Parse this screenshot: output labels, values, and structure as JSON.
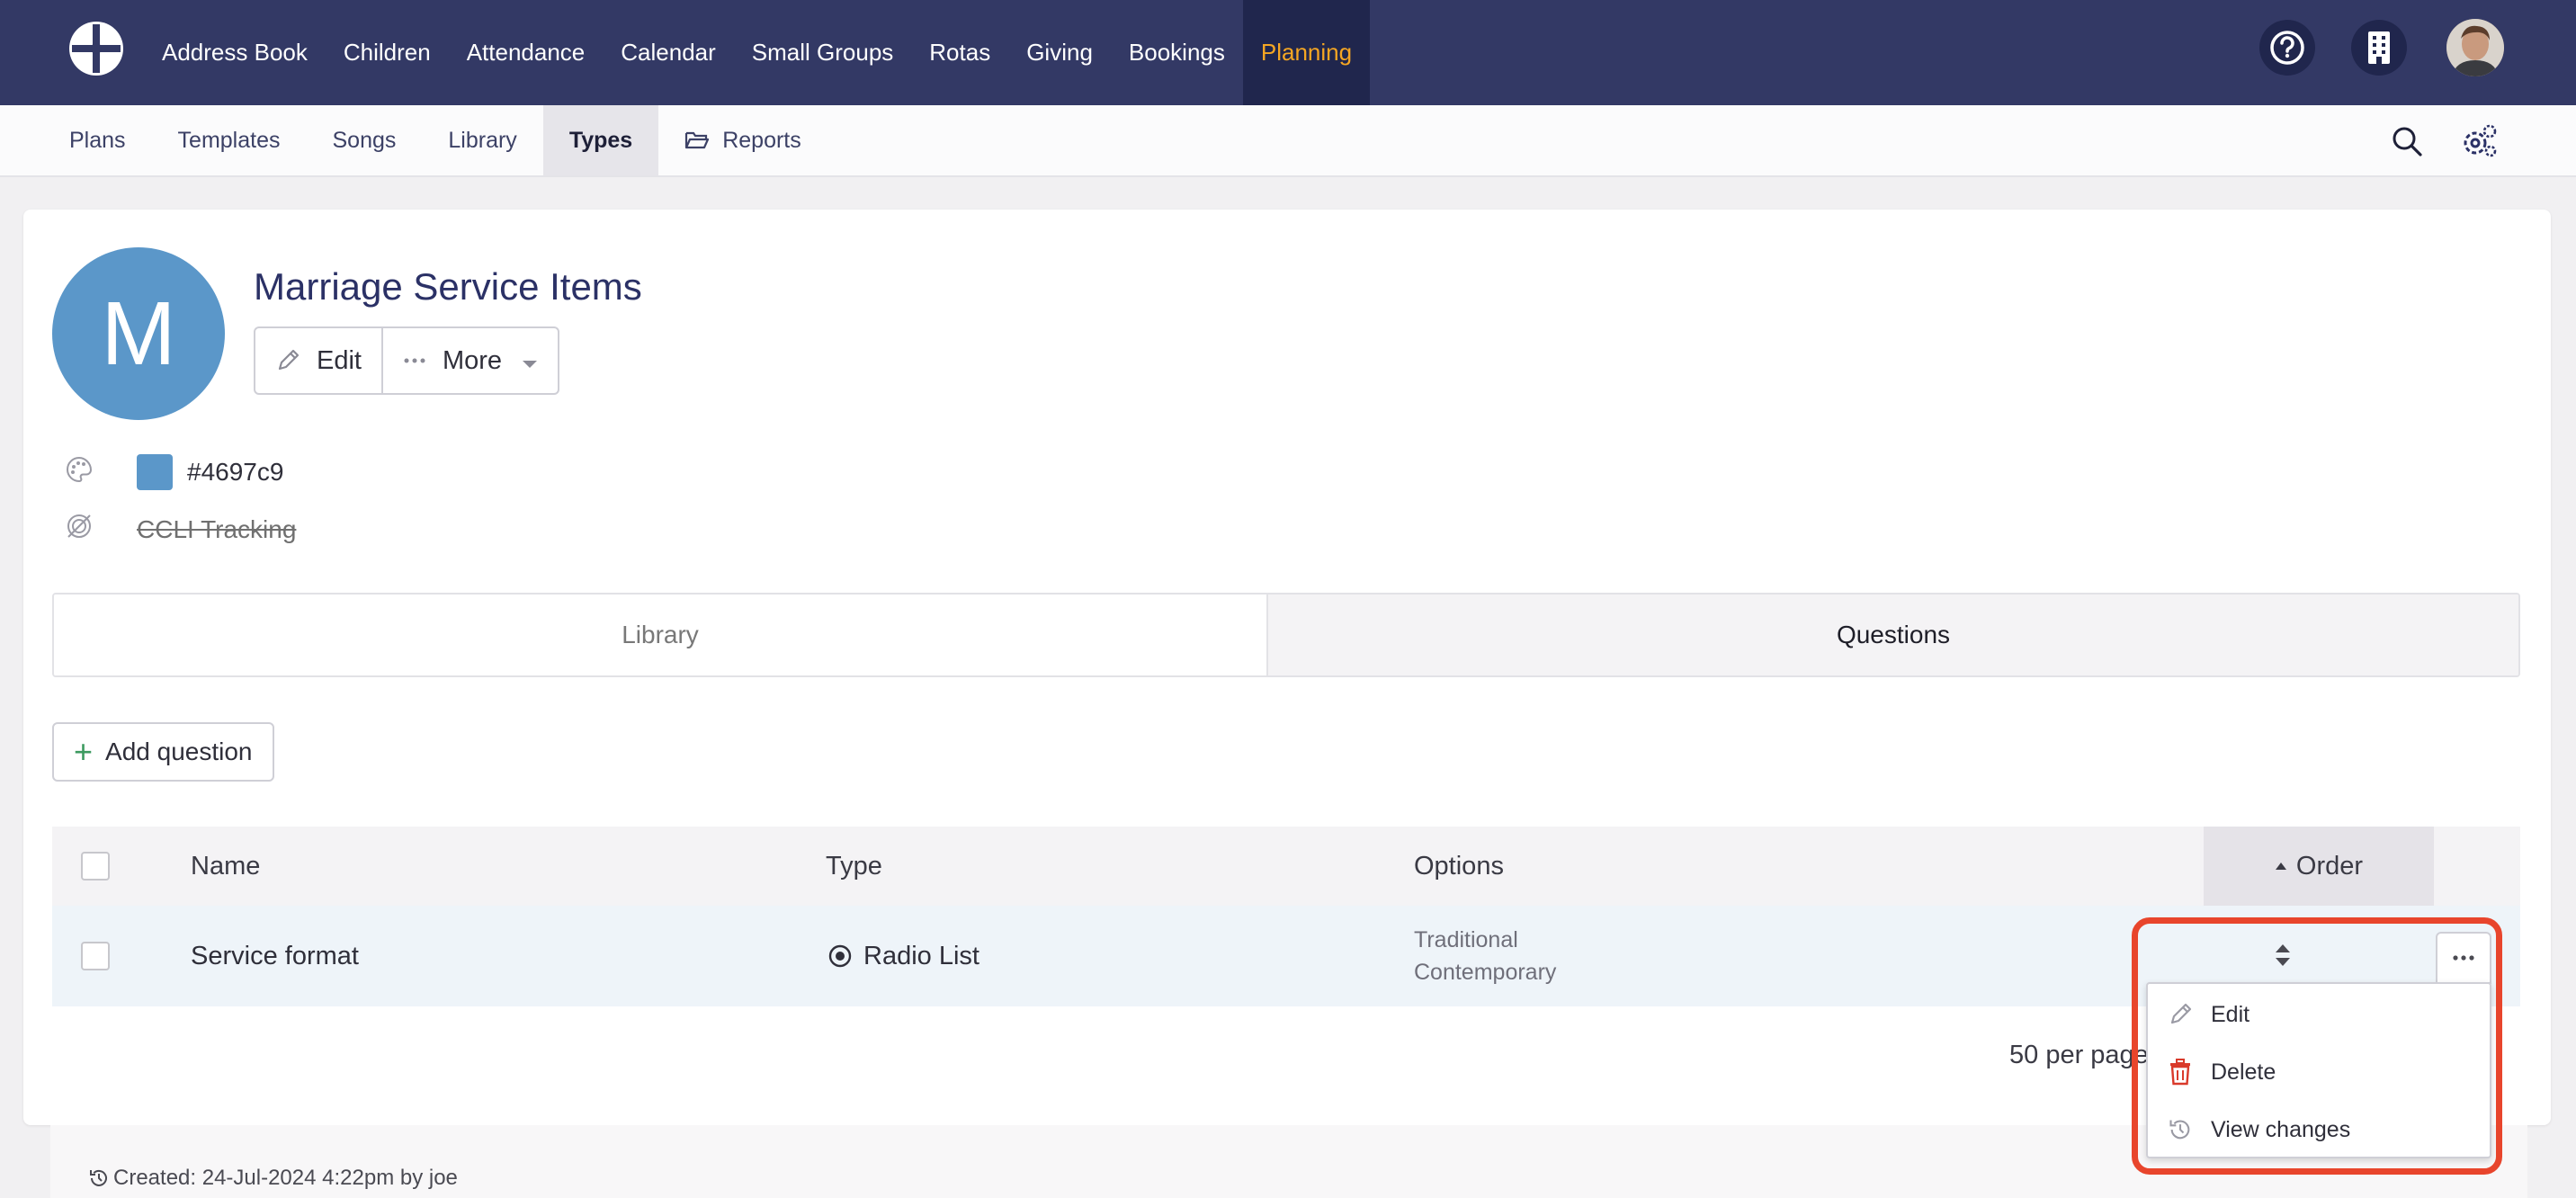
{
  "topnav": {
    "items": [
      "Address Book",
      "Children",
      "Attendance",
      "Calendar",
      "Small Groups",
      "Rotas",
      "Giving",
      "Bookings",
      "Planning"
    ],
    "active": "Planning",
    "icons": [
      "help-icon",
      "building-icon",
      "user-avatar"
    ]
  },
  "subnav": {
    "items": [
      "Plans",
      "Templates",
      "Songs",
      "Library",
      "Types",
      "Reports"
    ],
    "active": "Types",
    "icons": [
      "search-icon",
      "settings-icon"
    ]
  },
  "type": {
    "avatar_letter": "M",
    "title": "Marriage Service Items",
    "edit_label": "Edit",
    "more_label": "More",
    "color_value": "#4697c9",
    "ccli_label": "CCLI Tracking"
  },
  "tabs": [
    "Library",
    "Questions"
  ],
  "active_tab": "Questions",
  "add_question_label": "Add question",
  "table": {
    "headers": {
      "name": "Name",
      "type": "Type",
      "options": "Options",
      "order": "Order"
    },
    "rows": [
      {
        "name": "Service format",
        "type": "Radio List",
        "options": [
          "Traditional",
          "Contemporary"
        ]
      }
    ]
  },
  "per_page_label": "50 per page",
  "created_text": "Created: 24-Jul-2024 4:22pm by joe",
  "row_menu": {
    "items": [
      "Edit",
      "Delete",
      "View changes"
    ]
  },
  "colors": {
    "topbar": "#333965",
    "active_nav": "#f5a623",
    "avatar_bg": "#5b97c9",
    "swatch": "#4697c9",
    "highlight": "#e8452c",
    "delete": "#d93a2b"
  }
}
